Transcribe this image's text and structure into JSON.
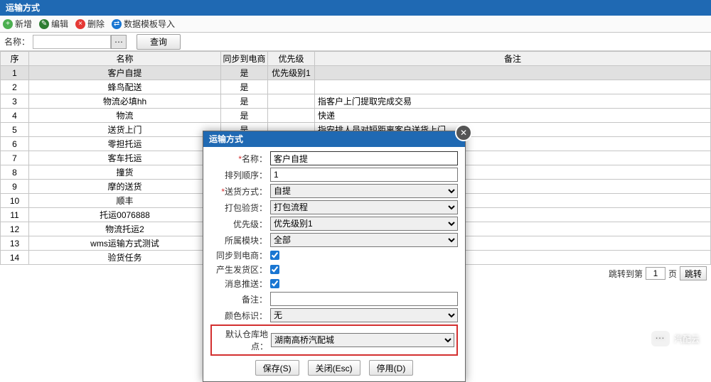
{
  "title": "运输方式",
  "toolbar": {
    "add": "新增",
    "edit": "编辑",
    "del": "删除",
    "import": "数据模板导入"
  },
  "filter": {
    "name_label": "名称：",
    "query": "查询"
  },
  "cols": {
    "idx": "序",
    "name": "名称",
    "sync": "同步到电商",
    "prio": "优先级",
    "note": "备注"
  },
  "rows": [
    {
      "i": "1",
      "name": "客户自提",
      "sync": "是",
      "prio": "优先级别1",
      "note": ""
    },
    {
      "i": "2",
      "name": "蜂鸟配送",
      "sync": "是",
      "prio": "",
      "note": ""
    },
    {
      "i": "3",
      "name": "物流必填hh",
      "sync": "是",
      "prio": "",
      "note": "指客户上门提取完成交易"
    },
    {
      "i": "4",
      "name": "物流",
      "sync": "是",
      "prio": "",
      "note": "快递"
    },
    {
      "i": "5",
      "name": "送货上门",
      "sync": "是",
      "prio": "",
      "note": "指安排人员对短距离客户送货上门"
    },
    {
      "i": "6",
      "name": "零担托运",
      "sync": "",
      "prio": "",
      "note": ""
    },
    {
      "i": "7",
      "name": "客车托运",
      "sync": "",
      "prio": "",
      "note": ""
    },
    {
      "i": "8",
      "name": "撞货",
      "sync": "",
      "prio": "",
      "note": ""
    },
    {
      "i": "9",
      "name": "摩的送货",
      "sync": "",
      "prio": "",
      "note": ""
    },
    {
      "i": "10",
      "name": "顺丰",
      "sync": "",
      "prio": "",
      "note": ""
    },
    {
      "i": "11",
      "name": "托运0076888",
      "sync": "",
      "prio": "",
      "note": ""
    },
    {
      "i": "12",
      "name": "物流托运2",
      "sync": "",
      "prio": "",
      "note": ""
    },
    {
      "i": "13",
      "name": "wms运输方式测试",
      "sync": "",
      "prio": "",
      "note": ""
    },
    {
      "i": "14",
      "name": "验货任务",
      "sync": "",
      "prio": "",
      "note": ""
    }
  ],
  "pager": {
    "jump": "跳转到第",
    "page": "1",
    "unit": "页",
    "go": "跳转"
  },
  "dlg": {
    "title": "运输方式",
    "labels": {
      "name": "名称：",
      "order": "排列顺序：",
      "ship": "送货方式：",
      "pack": "打包验货：",
      "prio": "优先级：",
      "mod": "所属模块：",
      "sync": "同步到电商：",
      "gen": "产生发货区：",
      "push": "消息推送：",
      "note": "备注：",
      "color": "颜色标识：",
      "loc": "默认仓库地点："
    },
    "vals": {
      "name": "客户自提",
      "order": "1",
      "ship": "自提",
      "pack": "打包流程",
      "prio": "优先级别1",
      "mod": "全部",
      "color": "无",
      "loc": "湖南高桥汽配城"
    },
    "btns": {
      "save": "保存(S)",
      "close": "关闭(Esc)",
      "disable": "停用(D)"
    }
  },
  "watermark": "汽配云"
}
